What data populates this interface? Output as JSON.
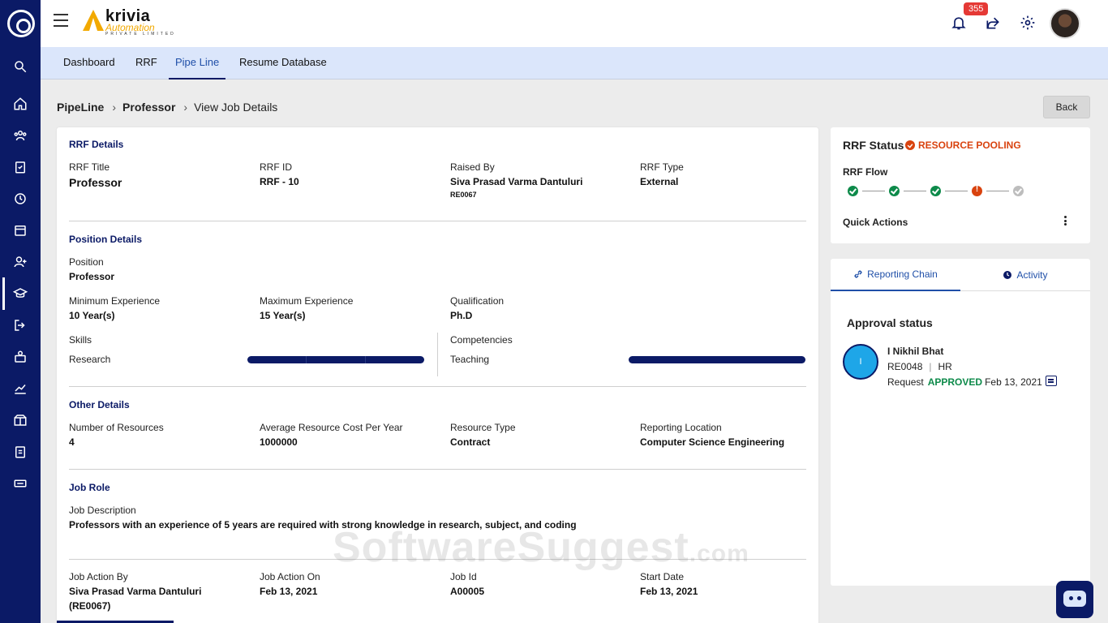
{
  "brand": {
    "name": "krivia",
    "sub": "Automation",
    "tiny": "PRIVATE LIMITED"
  },
  "header": {
    "notifications_count": "355"
  },
  "nav": {
    "tabs": [
      "Dashboard",
      "RRF",
      "Pipe Line",
      "Resume Database"
    ],
    "active": "Pipe Line"
  },
  "breadcrumb": {
    "root": "PipeLine",
    "level1": "Professor",
    "current": "View Job Details"
  },
  "actions": {
    "back_label": "Back"
  },
  "rrf_details": {
    "title": "RRF Details",
    "rrf_title_label": "RRF Title",
    "rrf_title_value": "Professor",
    "rrf_id_label": "RRF ID",
    "rrf_id_value": "RRF - 10",
    "raised_by_label": "Raised By",
    "raised_by_value": "Siva Prasad Varma Dantuluri",
    "raised_by_code": "RE0067",
    "rrf_type_label": "RRF Type",
    "rrf_type_value": "External"
  },
  "position_details": {
    "title": "Position Details",
    "position_label": "Position",
    "position_value": "Professor",
    "min_exp_label": "Minimum Experience",
    "min_exp_value": "10 Year(s)",
    "max_exp_label": "Maximum Experience",
    "max_exp_value": "15 Year(s)",
    "qualification_label": "Qualification",
    "qualification_value": "Ph.D",
    "skills_label": "Skills",
    "skill_name": "Research",
    "skill_level": 1.0,
    "competencies_label": "Competencies",
    "competency_name": "Teaching",
    "competency_level": 1.0
  },
  "other_details": {
    "title": "Other Details",
    "num_resources_label": "Number of Resources",
    "num_resources_value": "4",
    "avg_cost_label": "Average Resource Cost Per Year",
    "avg_cost_value": "1000000",
    "resource_type_label": "Resource Type",
    "resource_type_value": "Contract",
    "reporting_loc_label": "Reporting Location",
    "reporting_loc_value": "Computer Science Engineering"
  },
  "job_role": {
    "title": "Job Role",
    "desc_label": "Job Description",
    "desc_value": "Professors with an experience of 5 years are required with strong knowledge in research, subject, and coding"
  },
  "job_action": {
    "action_by_label": "Job Action By",
    "action_by_value": "Siva Prasad Varma Dantuluri",
    "action_by_code": "(RE0067)",
    "action_on_label": "Job Action On",
    "action_on_value": "Feb 13, 2021",
    "job_id_label": "Job Id",
    "job_id_value": "A00005",
    "start_date_label": "Start Date",
    "start_date_value": "Feb 13, 2021"
  },
  "rrf_status": {
    "title": "RRF Status",
    "status": "RESOURCE POOLING",
    "flow_label": "RRF Flow",
    "flow_steps": [
      "done",
      "done",
      "done",
      "alert",
      "pending"
    ],
    "quick_actions_label": "Quick Actions"
  },
  "reporting_chain": {
    "tab_chain": "Reporting Chain",
    "tab_activity": "Activity",
    "approval_title": "Approval status",
    "approver_initial": "I",
    "approver_name": "I Nikhil Bhat",
    "approver_code": "RE0048",
    "approver_dept": "HR",
    "request_label": "Request",
    "request_status": "APPROVED",
    "request_date": "Feb 13, 2021"
  },
  "watermark": {
    "main": "SoftwareSuggest",
    "suffix": ".com"
  },
  "colors": {
    "primary": "#0b1a66",
    "accent": "#1f4fa8",
    "success": "#0d8a4a",
    "warning": "#d9430f",
    "brand": "#f2a900"
  }
}
